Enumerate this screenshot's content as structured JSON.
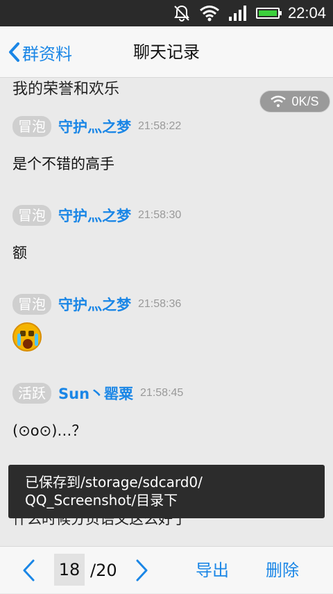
{
  "status_bar": {
    "time": "22:04",
    "icons": [
      "mute-bell-icon",
      "wifi-icon",
      "signal-icon",
      "battery-icon"
    ]
  },
  "header": {
    "back_label": "群资料",
    "title": "聊天记录"
  },
  "speed_indicator": {
    "value": "0K/S"
  },
  "chat": {
    "partial_top": "我的荣誉和欢乐",
    "messages": [
      {
        "badge": "冒泡",
        "nick": "守护灬之梦",
        "time": "21:58:22",
        "text": "是个不错的高手"
      },
      {
        "badge": "冒泡",
        "nick": "守护灬之梦",
        "time": "21:58:30",
        "text": "额"
      },
      {
        "badge": "冒泡",
        "nick": "守护灬之梦",
        "time": "21:58:36",
        "emoji": "crying-face-emoji"
      },
      {
        "badge": "活跃",
        "nick": "Sun丶罂粟",
        "time": "21:58:45",
        "text": "(⊙o⊙)…？"
      }
    ],
    "partial_bottom": "什么时候分页语文这么好了"
  },
  "toast": {
    "line1": "已保存到/storage/sdcard0/",
    "line2": "QQ_Screenshot/目录下"
  },
  "pager": {
    "current": "18",
    "total": "/20",
    "export_label": "导出",
    "delete_label": "删除"
  },
  "colors": {
    "accent": "#1a86e6",
    "badge": "#cfcfcf",
    "status_bar": "#2a2a2a"
  }
}
